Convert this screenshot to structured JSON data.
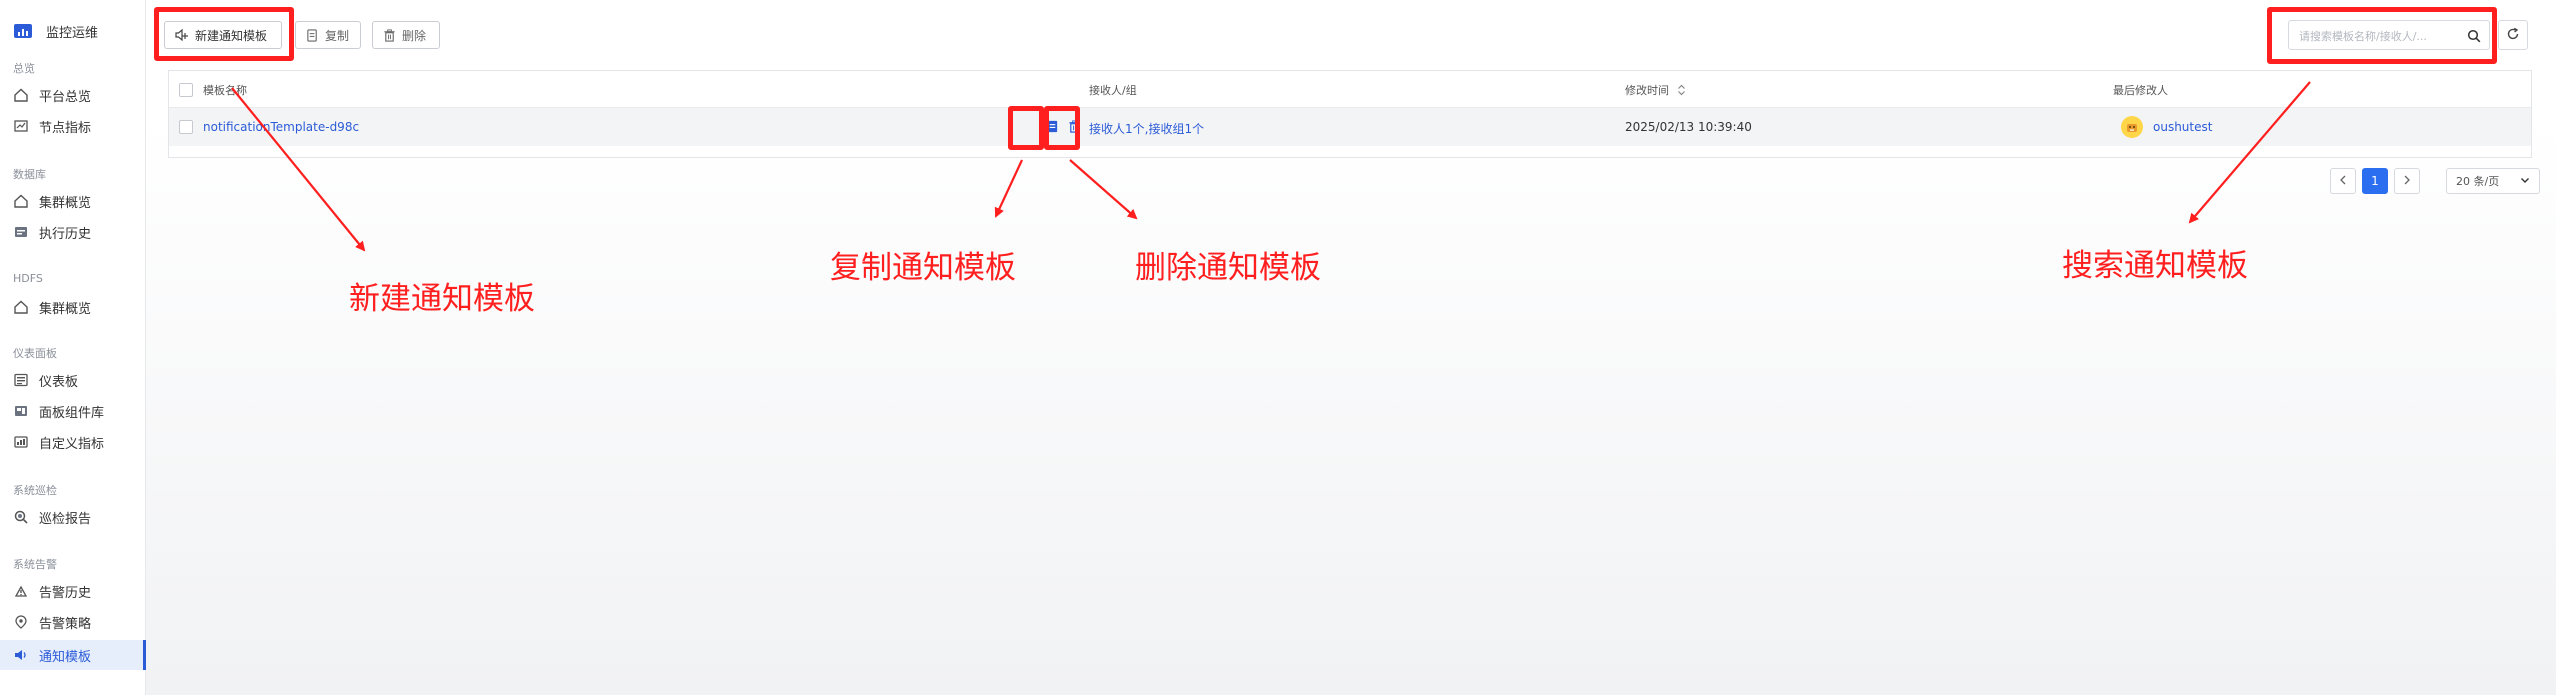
{
  "sidebar": {
    "brand_title": "监控运维",
    "groups": [
      {
        "label": "总览"
      },
      {
        "label": "数据库"
      },
      {
        "label": "HDFS"
      },
      {
        "label": "仪表面板"
      },
      {
        "label": "系统巡检"
      },
      {
        "label": "系统告警"
      }
    ],
    "items": [
      {
        "label": "平台总览",
        "icon": "home-icon"
      },
      {
        "label": "节点指标",
        "icon": "chart-icon"
      },
      {
        "label": "集群概览",
        "icon": "home-icon"
      },
      {
        "label": "执行历史",
        "icon": "history-icon"
      },
      {
        "label": "集群概览",
        "icon": "home-icon"
      },
      {
        "label": "仪表板",
        "icon": "dashboard-icon"
      },
      {
        "label": "面板组件库",
        "icon": "component-icon"
      },
      {
        "label": "自定义指标",
        "icon": "custom-metric-icon"
      },
      {
        "label": "巡检报告",
        "icon": "report-icon"
      },
      {
        "label": "告警历史",
        "icon": "alarm-history-icon"
      },
      {
        "label": "告警策略",
        "icon": "strategy-icon"
      },
      {
        "label": "通知模板",
        "icon": "speaker-icon",
        "active": true
      }
    ]
  },
  "toolbar": {
    "new_label": "新建通知模板",
    "copy_label": "复制",
    "delete_label": "删除"
  },
  "search": {
    "placeholder": "请搜索模板名称/接收人/..."
  },
  "table": {
    "columns": [
      "模板名称",
      "接收人/组",
      "修改时间",
      "最后修改人"
    ],
    "rows": [
      {
        "name": "notificationTemplate-d98c",
        "receivers": "接收人1个,接收组1个",
        "modified": "2025/02/13 10:39:40",
        "modifier": "oushutest"
      }
    ]
  },
  "pagination": {
    "current": "1",
    "page_size": "20 条/页"
  },
  "annotations": {
    "new": "新建通知模板",
    "copy": "复制通知模板",
    "delete": "删除通知模板",
    "search": "搜索通知模板"
  },
  "colors": {
    "accent": "#2b5bd7",
    "annotation": "#ff1f1f",
    "active_bg": "#e6eefc"
  }
}
